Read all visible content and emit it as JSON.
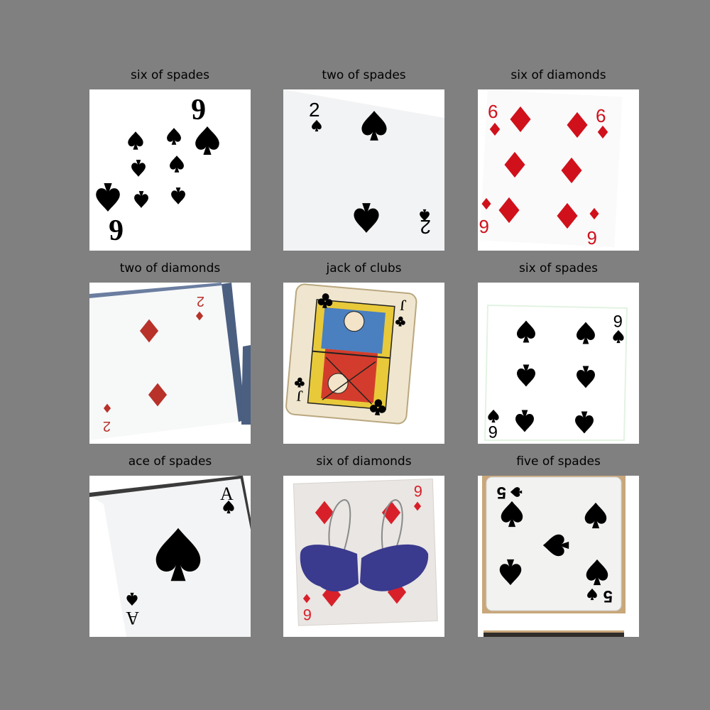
{
  "figure": {
    "background": "#808080",
    "cells": [
      {
        "title": "six of spades",
        "suit_color": "#000000"
      },
      {
        "title": "two of spades",
        "suit_color": "#000000"
      },
      {
        "title": "six of diamonds",
        "suit_color": "#d0111b"
      },
      {
        "title": "two of diamonds",
        "suit_color": "#b8322a"
      },
      {
        "title": "jack of clubs",
        "suit_color": "#000000"
      },
      {
        "title": "six of spades",
        "suit_color": "#000000"
      },
      {
        "title": "ace of spades",
        "suit_color": "#000000"
      },
      {
        "title": "six of diamonds",
        "suit_color": "#d8202a"
      },
      {
        "title": "five of spades",
        "suit_color": "#000000"
      }
    ]
  }
}
